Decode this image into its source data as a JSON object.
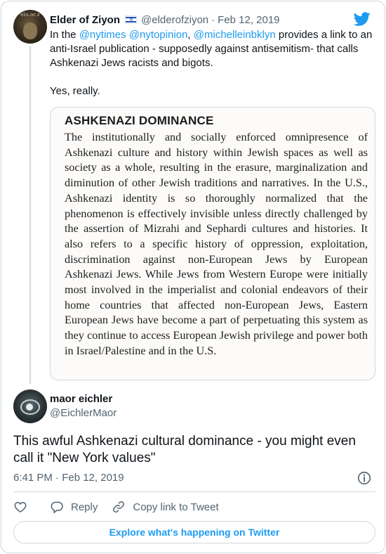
{
  "quoted_tweet": {
    "avatar_text": "elo.or.z",
    "name": "Elder of Ziyon",
    "handle": "@elderofziyon",
    "separator": "·",
    "date": "Feb 12, 2019",
    "text_parts": {
      "prefix": "In the ",
      "mention_1": "@nytimes",
      "mention_2": "@nytopinion",
      "comma": ", ",
      "mention_3": "@michelleinbklyn",
      "suffix": " provides a link to an anti-Israel publication - supposedly against antisemitism- that calls Ashkenazi Jews racists and bigots.",
      "second_line": "Yes, really."
    },
    "media": {
      "heading": "ASHKENAZI DOMINANCE",
      "body": "The institutionally and socially enforced omnipresence of Ashkenazi culture and history within Jewish spaces as well as society as a whole, resulting in the erasure, marginalization and diminution of other Jewish traditions and narratives. In the U.S., Ashkenazi identity is so thoroughly normalized that the phenomenon is effectively invisible unless directly challenged by the assertion of Mizrahi and Sephardi cultures and histories. It also refers to a specific history of oppression, exploitation, discrimination against non-European Jews by European Ashkenazi Jews. While Jews from Western Europe were initially most involved in the imperialist and colonial endeavors of their home countries that affected non-European Jews, Eastern European Jews have become a part of perpetuating this system as they continue to access European Jewish privilege and power both in Israel/Palestine and in the U.S."
    }
  },
  "main_tweet": {
    "name": "maor eichler",
    "handle": "@EichlerMaor",
    "text": "This awful Ashkenazi cultural dominance - you might even call it \"New York values\"",
    "timestamp": "6:41 PM · Feb 12, 2019"
  },
  "actions": {
    "reply_label": "Reply",
    "copy_link_label": "Copy link to Tweet"
  },
  "explore_label": "Explore what's happening on Twitter",
  "icons": {
    "brand": "twitter-bird-icon",
    "flag": "israel-flag-icon",
    "like": "heart-icon",
    "reply": "reply-bubble-icon",
    "copy": "link-icon",
    "info": "info-icon"
  },
  "colors": {
    "accent": "#1d9bf0",
    "text": "#0f1419",
    "muted": "#536471",
    "border": "#cfd9de"
  }
}
